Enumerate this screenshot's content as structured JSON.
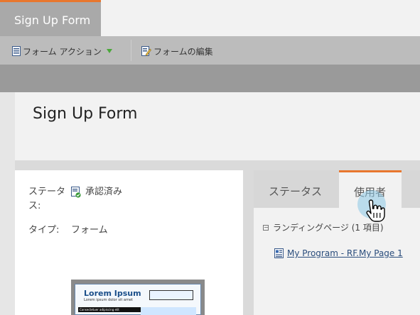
{
  "document_tab": {
    "label": "Sign Up Form"
  },
  "toolbar": {
    "form_actions_label": "フォーム アクション",
    "edit_form_label": "フォームの編集"
  },
  "page": {
    "title": "Sign Up Form"
  },
  "info": {
    "status_label_line1": "ステータ",
    "status_label_line2": "ス:",
    "status_value": "承認済み",
    "type_label": "タイプ:",
    "type_value": "フォーム"
  },
  "thumbnail": {
    "title": "Lorem Ipsum",
    "subtitle": "Lorem ipsum dolor sit amet",
    "bar_text": "Consectetuer adipiscing elit"
  },
  "side_panel": {
    "tabs": [
      {
        "label": "ステータス",
        "active": false
      },
      {
        "label": "使用者",
        "active": true
      }
    ],
    "tree": {
      "group_label": "ランディングページ (1 項目)",
      "items": [
        {
          "label": "My Program - RF.My Page 1"
        }
      ]
    }
  },
  "colors": {
    "accent": "#e8772e",
    "link": "#2a4d7c",
    "approved_check": "#3a9a3a"
  },
  "icons": [
    "form-actions-icon",
    "dropdown-arrow-icon",
    "edit-form-icon",
    "approved-status-icon",
    "tree-collapse-icon",
    "landing-page-icon",
    "hand-pointer-icon"
  ]
}
